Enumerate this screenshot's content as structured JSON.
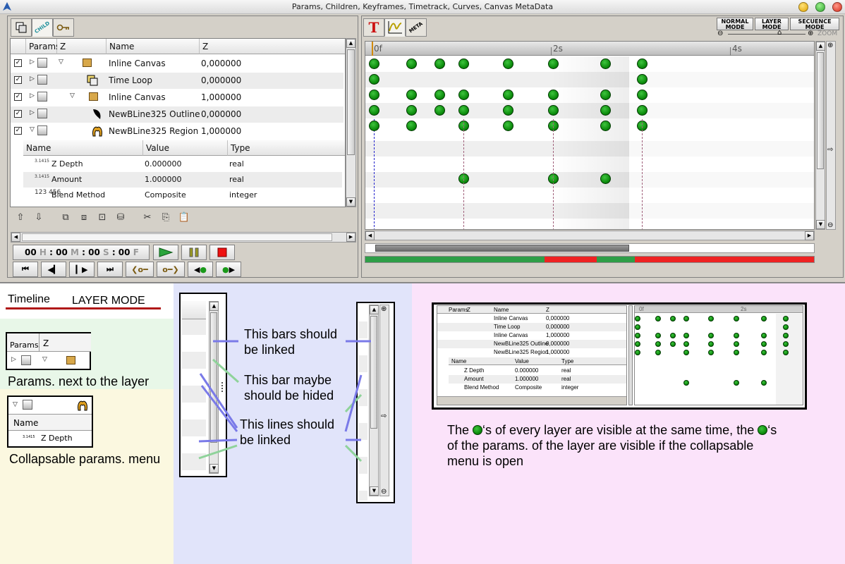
{
  "window": {
    "title": "Params, Children, Keyframes, Timetrack, Curves, Canvas MetaData"
  },
  "left_panel": {
    "tabs": [
      {
        "label": "CHILD"
      }
    ],
    "headers": {
      "params": "Params",
      "z_short": "Z",
      "name": "Name",
      "z": "Z"
    },
    "layers": [
      {
        "name": "Inline Canvas",
        "z": "0,000000"
      },
      {
        "name": "Time Loop",
        "z": "0,000000"
      },
      {
        "name": "Inline Canvas",
        "z": "1,000000"
      },
      {
        "name": "NewBLine325 Outline",
        "z": "0,000000"
      },
      {
        "name": "NewBLine325 Region",
        "z": "1,000000"
      }
    ],
    "param_headers": {
      "name": "Name",
      "value": "Value",
      "type": "Type"
    },
    "params": [
      {
        "icon": "3.1415",
        "name": "Z Depth",
        "value": "0.000000",
        "type": "real"
      },
      {
        "icon": "3.1415",
        "name": "Amount",
        "value": "1.000000",
        "type": "real"
      },
      {
        "icon": "123 456",
        "name": "Blend Method",
        "value": "Composite",
        "type": "integer"
      }
    ],
    "time": {
      "h": "00",
      "h_unit": "H",
      "m": "00",
      "m_unit": "M",
      "s": "00",
      "s_unit": "S",
      "f": "00",
      "f_unit": "F"
    }
  },
  "right_panel": {
    "tabs": [
      {
        "label": "META"
      }
    ],
    "modes": [
      {
        "line1": "NORMAL",
        "line2": "MODE"
      },
      {
        "line1": "LAYER",
        "line2": "MODE"
      },
      {
        "line1": "SECUENCE",
        "line2": "MODE"
      }
    ],
    "zoom_label": "ZOOM",
    "ruler": [
      "0f",
      "2s",
      "4s"
    ],
    "keyframes": {
      "frame_columns": [
        "c0",
        "c1",
        "c2",
        "c3",
        "c4",
        "c5",
        "c6",
        "c7"
      ],
      "rows": [
        [
          "c0",
          "c1",
          "c2",
          "c3",
          "c4",
          "c5",
          "c6",
          "c7"
        ],
        [
          "c0",
          "c7"
        ],
        [
          "c0",
          "c1",
          "c2",
          "c3",
          "c4",
          "c5",
          "c6",
          "c7"
        ],
        [
          "c0",
          "c1",
          "c2",
          "c3",
          "c4",
          "c5",
          "c6",
          "c7"
        ],
        [
          "c0",
          "c1",
          "c3",
          "c4",
          "c5",
          "c6",
          "c7"
        ],
        [],
        [],
        [
          "c3",
          "c5",
          "c6"
        ]
      ]
    },
    "colors": {
      "keyframe": "#0b8a0b",
      "timebar_green": "#2e9e47",
      "timebar_red": "#ee2222"
    }
  },
  "notes": {
    "timeline": "Timeline",
    "layer_mode": "LAYER MODE",
    "mini_params": "Params.",
    "mini_z": "Z",
    "params_next": "Params. next to the layer",
    "mini_name": "Name",
    "mini_zdepth": "Z Depth",
    "mini_icon": "3.1415",
    "collapsable": "Collapsable params. menu",
    "bars_linked_1": "This bars should",
    "bars_linked_2": "be linked",
    "bar_hide_1": "This bar maybe",
    "bar_hide_2": "should be hided",
    "lines_linked_1": "This lines should",
    "lines_linked_2": "be linked",
    "explain_1a": "The",
    "explain_1b": "‘s of every layer are visible at the same time, the",
    "explain_1c": "‘s",
    "explain_2": "of the params. of the layer are visible if the collapsable",
    "explain_3": "menu is open"
  },
  "preview": {
    "headers": {
      "params": "Params",
      "z_short": "Z",
      "name": "Name",
      "z": "Z"
    },
    "layers": [
      {
        "name": "Inline Canvas",
        "z": "0,000000"
      },
      {
        "name": "Time Loop",
        "z": "0,000000"
      },
      {
        "name": "Inline Canvas",
        "z": "1,000000"
      },
      {
        "name": "NewBLine325 Outline",
        "z": "0,000000"
      },
      {
        "name": "NewBLine325 Region",
        "z": "1,000000"
      }
    ],
    "param_headers": {
      "name": "Name",
      "value": "Value",
      "type": "Type"
    },
    "params": [
      {
        "name": "Z Depth",
        "value": "0.000000",
        "type": "real"
      },
      {
        "name": "Amount",
        "value": "1.000000",
        "type": "real"
      },
      {
        "name": "Blend Method",
        "value": "Composite",
        "type": "integer"
      }
    ],
    "ruler": [
      "0f",
      "2s"
    ]
  }
}
